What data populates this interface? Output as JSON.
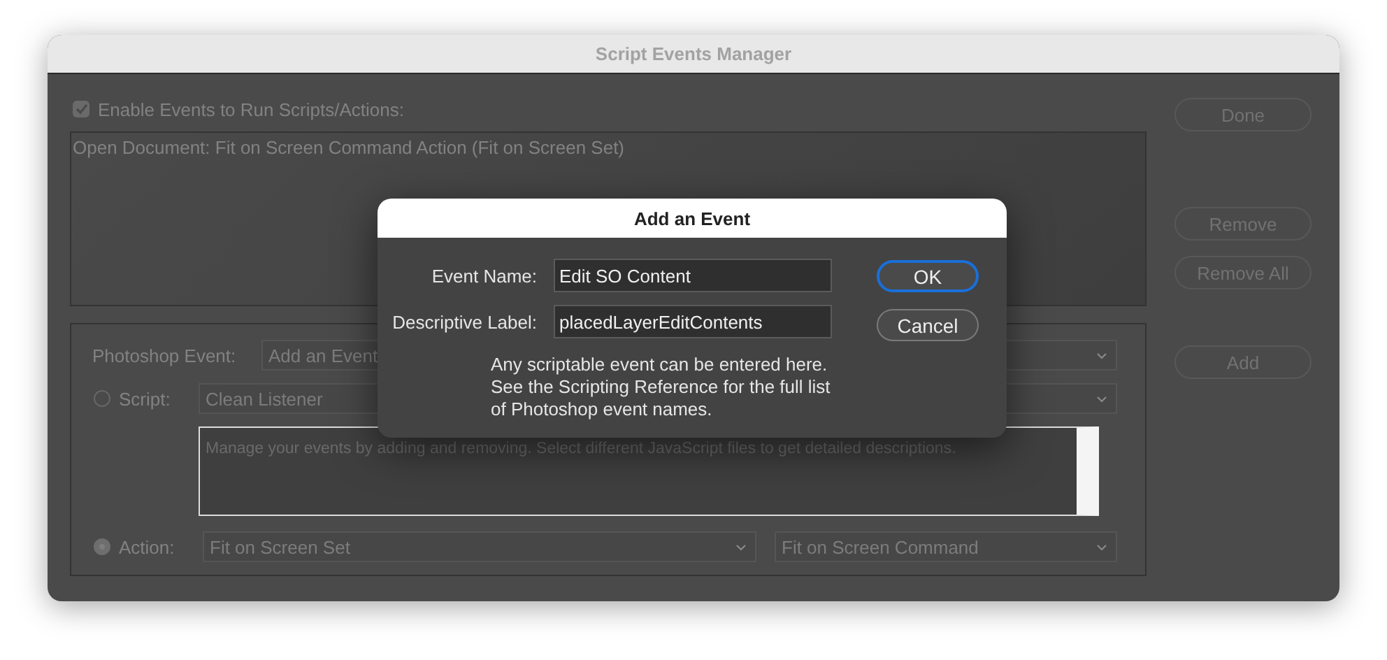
{
  "window": {
    "title": "Script Events Manager"
  },
  "enable_events": {
    "label": "Enable Events to Run Scripts/Actions:",
    "checked": true
  },
  "event_list": [
    "Open Document: Fit on Screen Command Action (Fit on Screen Set)"
  ],
  "buttons": [
    {
      "label": "Done"
    },
    {
      "label": "Remove"
    },
    {
      "label": "Remove All"
    },
    {
      "label": "Add"
    }
  ],
  "photoshop_event": {
    "label": "Photoshop Event:",
    "value": "Add an Event"
  },
  "script": {
    "label": "Script:",
    "selected": false,
    "value": "Clean Listener"
  },
  "description": "Manage your events by adding and removing. Select different JavaScript files to get detailed descriptions.",
  "action": {
    "label": "Action:",
    "selected": true,
    "set": "Fit on Screen Set",
    "command": "Fit on Screen Command"
  },
  "dialog": {
    "title": "Add an Event",
    "fields": [
      {
        "label": "Event Name:",
        "value": "Edit SO Content"
      },
      {
        "label": "Descriptive Label:",
        "value": "placedLayerEditContents"
      }
    ],
    "buttons": [
      {
        "label": "OK",
        "default": true
      },
      {
        "label": "Cancel",
        "default": false
      }
    ],
    "note": [
      "Any scriptable event can be entered here.",
      "See the Scripting Reference for the full list",
      "of Photoshop event names."
    ]
  }
}
